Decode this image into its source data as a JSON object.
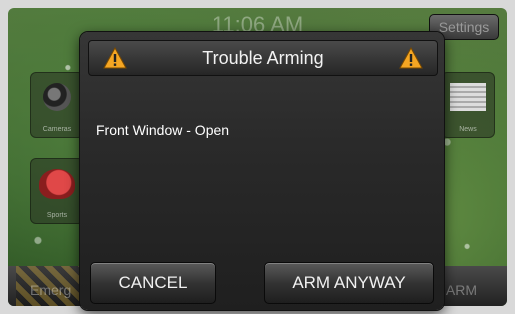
{
  "background": {
    "clock": "11:06 AM",
    "settings_label": "Settings",
    "tiles": {
      "cameras": "Cameras",
      "sports": "Sports",
      "news": "News"
    },
    "bottom_left_label": "Emerg",
    "bottom_right_label": "ARM"
  },
  "dialog": {
    "title": "Trouble Arming",
    "message": "Front Window - Open",
    "cancel_label": "CANCEL",
    "arm_label": "ARM ANYWAY",
    "warning_icon": "warning-triangle-icon",
    "warning_color": "#f5a623"
  }
}
